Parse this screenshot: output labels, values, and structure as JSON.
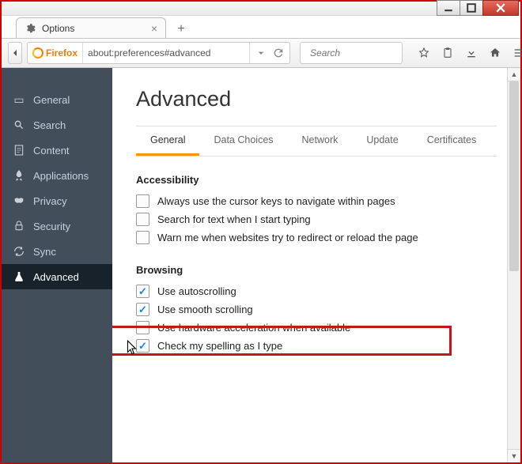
{
  "tab": {
    "title": "Options"
  },
  "identity": {
    "label": "Firefox"
  },
  "url": "about:preferences#advanced",
  "search": {
    "placeholder": "Search"
  },
  "sidebar": {
    "items": [
      {
        "label": "General"
      },
      {
        "label": "Search"
      },
      {
        "label": "Content"
      },
      {
        "label": "Applications"
      },
      {
        "label": "Privacy"
      },
      {
        "label": "Security"
      },
      {
        "label": "Sync"
      },
      {
        "label": "Advanced"
      }
    ]
  },
  "page": {
    "title": "Advanced",
    "subtabs": [
      "General",
      "Data Choices",
      "Network",
      "Update",
      "Certificates"
    ],
    "accessibility": {
      "title": "Accessibility",
      "opt0": "Always use the cursor keys to navigate within pages",
      "opt1": "Search for text when I start typing",
      "opt2": "Warn me when websites try to redirect or reload the page"
    },
    "browsing": {
      "title": "Browsing",
      "opt0": "Use autoscrolling",
      "opt1": "Use smooth scrolling",
      "opt2": "Use hardware acceleration when available",
      "opt3": "Check my spelling as I type"
    }
  }
}
